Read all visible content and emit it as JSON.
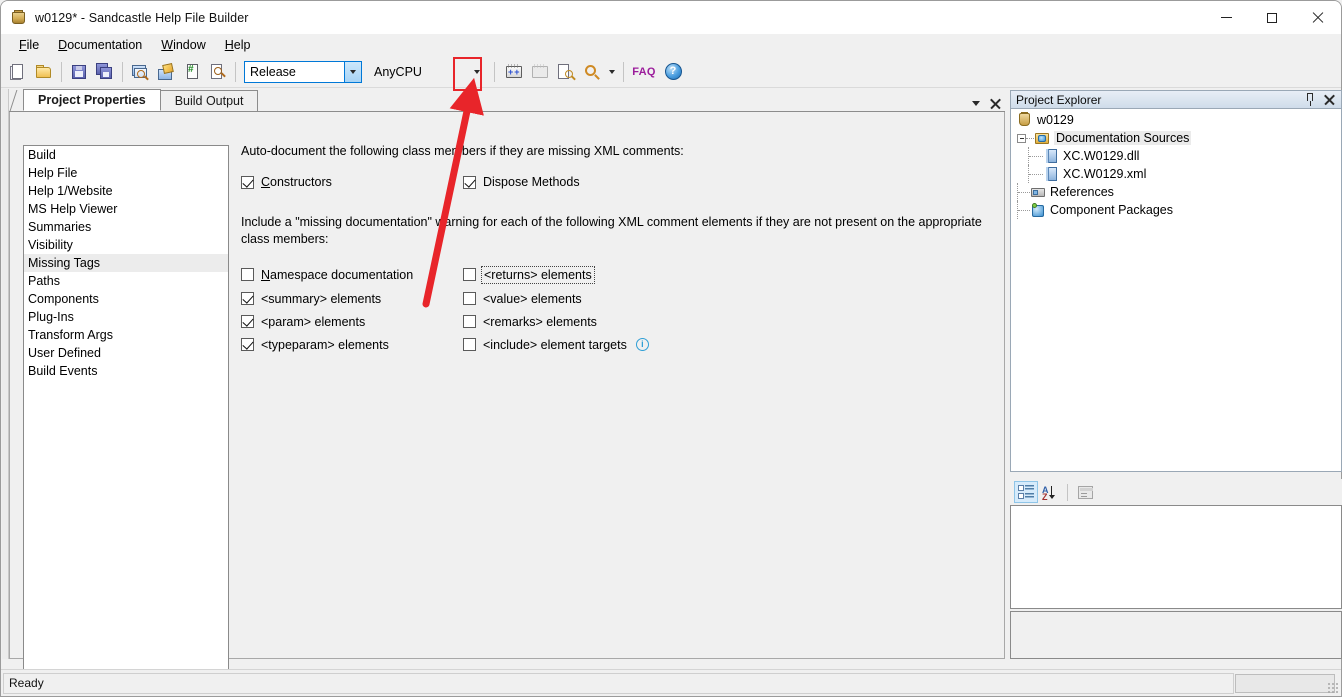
{
  "window": {
    "title": "w0129* - Sandcastle Help File Builder",
    "icon": "sandcastle-icon",
    "controls": {
      "minimize": "minimize",
      "maximize": "maximize",
      "close": "close"
    }
  },
  "menubar": {
    "items": [
      {
        "label": "File",
        "accel": "F"
      },
      {
        "label": "Documentation",
        "accel": "D"
      },
      {
        "label": "Window",
        "accel": "W"
      },
      {
        "label": "Help",
        "accel": "H"
      }
    ]
  },
  "toolbar": {
    "buttons": [
      {
        "name": "new-project",
        "tip": "New Project"
      },
      {
        "name": "open-project",
        "tip": "Open Project"
      },
      {
        "name": "save-project",
        "tip": "Save Project"
      },
      {
        "name": "save-all",
        "tip": "Save All"
      },
      {
        "name": "view-help-file",
        "tip": "View Help File"
      },
      {
        "name": "build-project",
        "tip": "Build Project"
      },
      {
        "name": "view-build-log",
        "tip": "View Build Log"
      },
      {
        "name": "preview-topic",
        "tip": "Preview Topic"
      }
    ],
    "configuration": {
      "value": "Release",
      "label": "Configuration"
    },
    "platform": {
      "value": "AnyCPU",
      "label": "Platform"
    },
    "entity_references": {
      "name": "entity-references-button",
      "highlighted": true
    },
    "paste_special": {
      "name": "paste-special-button",
      "disabled": true
    },
    "project_properties": {
      "name": "project-properties-button"
    },
    "search": {
      "name": "search-button"
    },
    "faq_label": "FAQ",
    "help_label": "?"
  },
  "tabs": {
    "items": [
      {
        "label": "Project Properties",
        "active": true
      },
      {
        "label": "Build Output",
        "active": false
      }
    ],
    "window_list_icon": "chevron-down-icon",
    "close_icon": "close-icon"
  },
  "categories": {
    "items": [
      {
        "label": "Build",
        "selected": false
      },
      {
        "label": "Help File",
        "selected": false
      },
      {
        "label": "Help 1/Website",
        "selected": false
      },
      {
        "label": "MS Help Viewer",
        "selected": false
      },
      {
        "label": "Summaries",
        "selected": false
      },
      {
        "label": "Visibility",
        "selected": false
      },
      {
        "label": "Missing Tags",
        "selected": true
      },
      {
        "label": "Paths",
        "selected": false
      },
      {
        "label": "Components",
        "selected": false
      },
      {
        "label": "Plug-Ins",
        "selected": false
      },
      {
        "label": "Transform Args",
        "selected": false
      },
      {
        "label": "User Defined",
        "selected": false
      },
      {
        "label": "Build Events",
        "selected": false
      }
    ]
  },
  "missing_tags": {
    "auto_document_heading": "Auto-document the following class members if they are missing XML comments:",
    "auto_document_options": [
      {
        "label": "Constructors",
        "accel": "C",
        "checked": true
      },
      {
        "label": "Dispose Methods",
        "accel": "",
        "checked": true
      }
    ],
    "warning_heading_line1": "Include a \"missing documentation\" warning for each of the following XML comment elements if they are not present on the appropriate",
    "warning_heading_line2": "class members:",
    "warning_options_left": [
      {
        "label": "Namespace documentation",
        "accel": "N",
        "checked": false
      },
      {
        "label": "<summary> elements",
        "accel": "",
        "checked": true
      },
      {
        "label": "<param> elements",
        "accel": "",
        "checked": true
      },
      {
        "label": "<typeparam> elements",
        "accel": "",
        "checked": true
      }
    ],
    "warning_options_right": [
      {
        "label": "<returns> elements",
        "accel": "",
        "checked": false,
        "focused": true
      },
      {
        "label": "<value> elements",
        "accel": "",
        "checked": false,
        "focused": false
      },
      {
        "label": "<remarks> elements",
        "accel": "",
        "checked": false,
        "focused": false
      },
      {
        "label": "<include> element targets",
        "accel": "",
        "checked": false,
        "focused": false,
        "info": true
      }
    ],
    "info_icon_label": "i"
  },
  "project_explorer": {
    "title": "Project Explorer",
    "pin_icon": "pin-icon",
    "close_icon": "close-icon",
    "tree": [
      {
        "label": "w0129",
        "icon": "project-icon",
        "depth": 0,
        "expander": false,
        "highlight": false
      },
      {
        "label": "Documentation Sources",
        "icon": "documentation-sources-icon",
        "depth": 1,
        "expander": true,
        "highlight": true
      },
      {
        "label": "XC.W0129.dll",
        "icon": "file-icon",
        "depth": 2,
        "expander": false,
        "highlight": false
      },
      {
        "label": "XC.W0129.xml",
        "icon": "file-icon",
        "depth": 2,
        "expander": false,
        "highlight": false
      },
      {
        "label": "References",
        "icon": "references-icon",
        "depth": 1,
        "expander": false,
        "highlight": false
      },
      {
        "label": "Component Packages",
        "icon": "component-packages-icon",
        "depth": 1,
        "expander": false,
        "highlight": false
      }
    ]
  },
  "properties_panel": {
    "toolbar": [
      {
        "name": "categorized-button",
        "icon": "categorized-icon",
        "active": true
      },
      {
        "name": "alphabetical-button",
        "icon": "sort-az-icon",
        "active": false
      },
      {
        "name": "property-pages-button",
        "icon": "property-pages-icon",
        "active": false
      }
    ],
    "grid_rows": [],
    "description": ""
  },
  "statusbar": {
    "message": "Ready",
    "progress": ""
  },
  "annotation": {
    "type": "red-arrow",
    "highlight_box": "entity-references-button",
    "color": "#e8252a"
  },
  "colors": {
    "accent": "#0078d7",
    "annotation": "#e8252a",
    "faq": "#9b1c9b",
    "panel_bg": "#f0f0f0",
    "selection": "#ececec"
  }
}
